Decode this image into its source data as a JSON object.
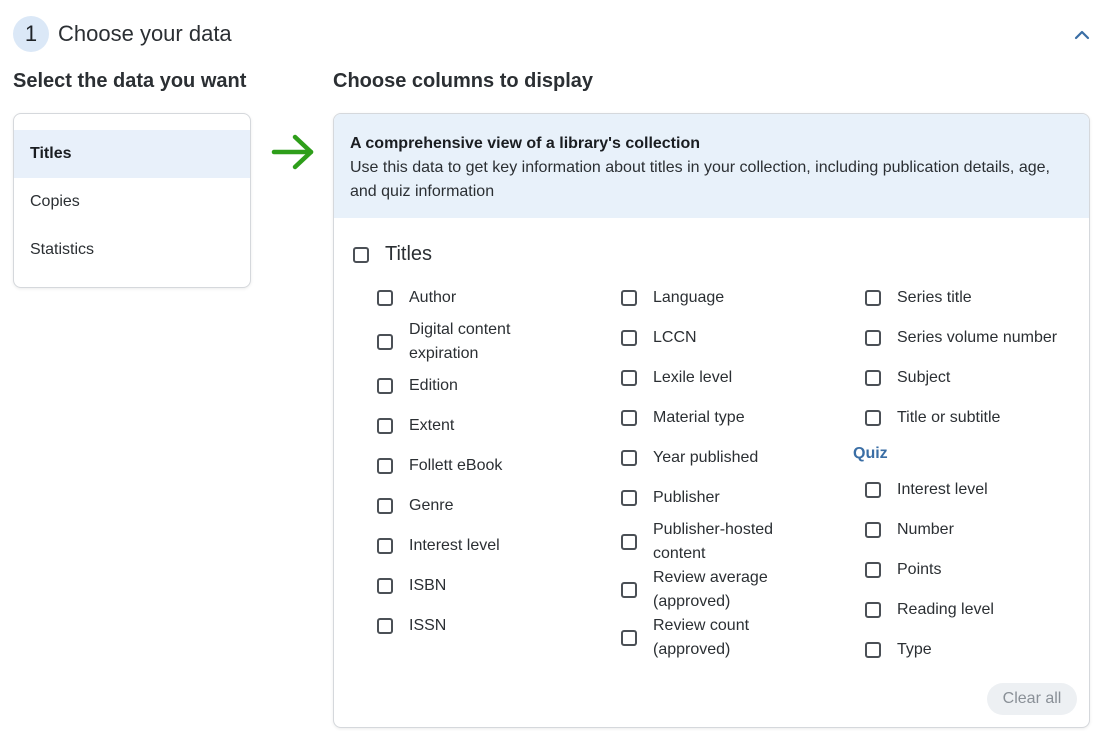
{
  "step": {
    "number": "1",
    "title": "Choose your data"
  },
  "left": {
    "heading": "Select the data you want",
    "items": [
      {
        "label": "Titles",
        "selected": true
      },
      {
        "label": "Copies",
        "selected": false
      },
      {
        "label": "Statistics",
        "selected": false
      }
    ]
  },
  "right": {
    "heading": "Choose columns to display",
    "info_title": "A comprehensive view of a library's collection",
    "info_desc": "Use this data to get key information about titles in your collection, including publication details, age, and quiz information",
    "group_label": "Titles",
    "col1": [
      "Author",
      "Digital content expiration",
      "Edition",
      "Extent",
      "Follett eBook",
      "Genre",
      "Interest level",
      "ISBN",
      "ISSN"
    ],
    "col2": [
      "Language",
      "LCCN",
      "Lexile level",
      "Material type",
      "Year published",
      "Publisher",
      "Publisher-hosted content",
      "Review average (approved)",
      "Review count (approved)"
    ],
    "col3": [
      "Series title",
      "Series volume number",
      "Subject",
      "Title or subtitle"
    ],
    "quiz_label": "Quiz",
    "quiz": [
      "Interest level",
      "Number",
      "Points",
      "Reading level",
      "Type"
    ],
    "clear_label": "Clear all"
  },
  "colors": {
    "accent": "#3a6ea5",
    "arrow": "#2e9e1a",
    "info_bg": "#e8f1fa"
  },
  "icons": {
    "collapse": "chevron-up-icon",
    "arrow": "arrow-right-icon"
  }
}
